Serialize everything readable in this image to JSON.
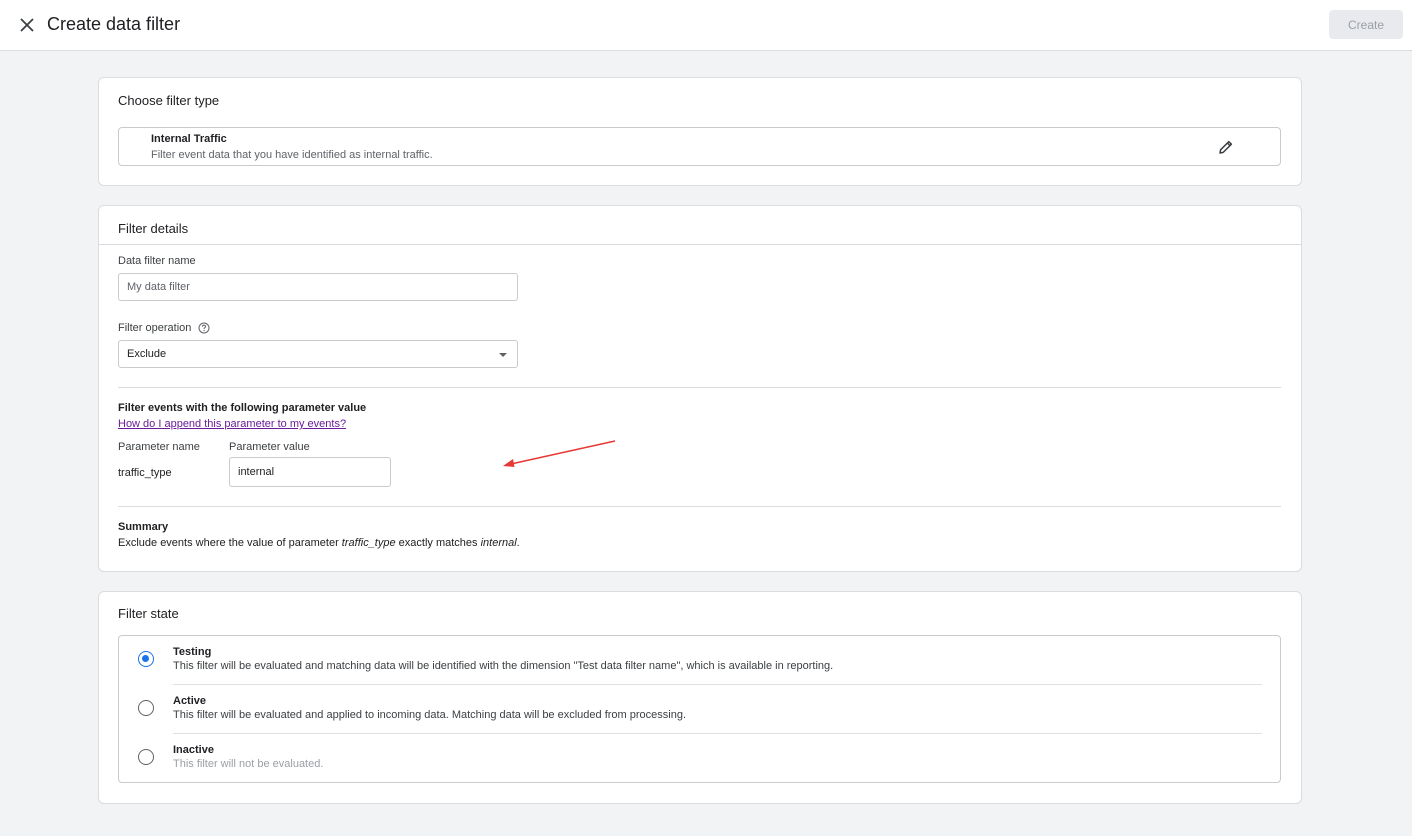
{
  "header": {
    "title": "Create data filter",
    "create_label": "Create"
  },
  "filter_type": {
    "section_title": "Choose filter type",
    "name": "Internal Traffic",
    "description": "Filter event data that you have identified as internal traffic."
  },
  "filter_details": {
    "section_title": "Filter details",
    "name_label": "Data filter name",
    "name_placeholder": "My data filter",
    "operation_label": "Filter operation",
    "operation_value": "Exclude",
    "param_section_title": "Filter events with the following parameter value",
    "help_link": "How do I append this parameter to my events?",
    "param_name_header": "Parameter name",
    "param_value_header": "Parameter value",
    "param_name": "traffic_type",
    "param_value": "internal",
    "summary_title": "Summary",
    "summary_prefix": "Exclude events where the value of parameter ",
    "summary_param": "traffic_type",
    "summary_middle": " exactly matches ",
    "summary_value": "internal",
    "summary_suffix": "."
  },
  "filter_state": {
    "section_title": "Filter state",
    "selected": "Testing",
    "options": [
      {
        "name": "Testing",
        "description": "This filter will be evaluated and matching data will be identified with the dimension \"Test data filter name\", which is available in reporting."
      },
      {
        "name": "Active",
        "description": "This filter will be evaluated and applied to incoming data. Matching data will be excluded from processing."
      },
      {
        "name": "Inactive",
        "description": "This filter will not be evaluated."
      }
    ]
  },
  "colors": {
    "accent": "#1a73e8",
    "annotation_arrow": "#e53935",
    "link": "#6a1b9a",
    "page_background": "#f1f3f4"
  }
}
